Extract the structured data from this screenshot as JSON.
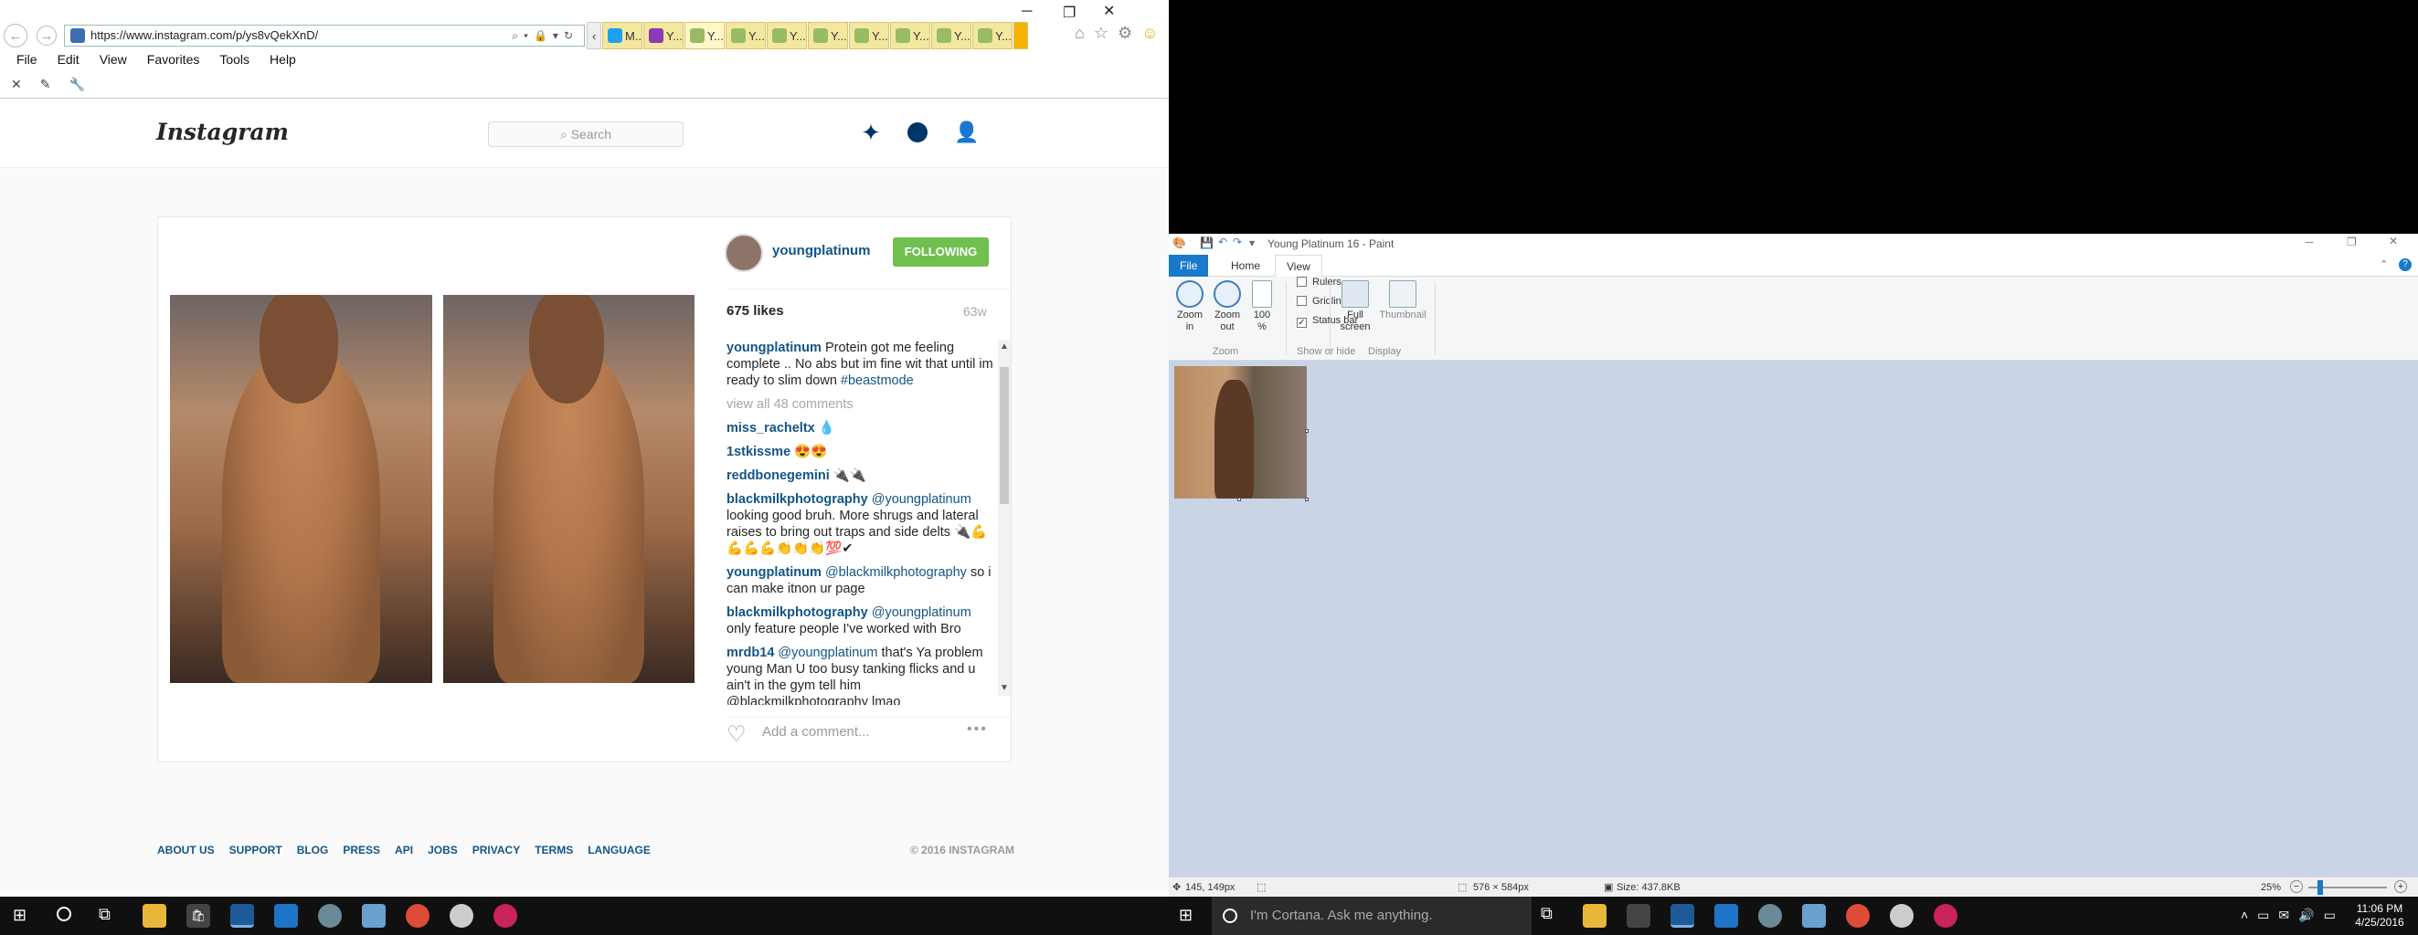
{
  "browser": {
    "url": "https://www.instagram.com/p/ys8vQekXnD/",
    "tabs": [
      "M...",
      "Y...",
      "Y... ×",
      "Y...",
      "Y...",
      "Y...",
      "Y...",
      "Y...",
      "Y...",
      "Y..."
    ],
    "menu": [
      "File",
      "Edit",
      "View",
      "Favorites",
      "Tools",
      "Help"
    ]
  },
  "instagram": {
    "logo": "Instagram",
    "search_placeholder": "Search",
    "username": "youngplatinum",
    "follow_label": "FOLLOWING",
    "likes": "675 likes",
    "age": "63w",
    "caption_user": "youngplatinum",
    "caption_text": "Protein got me feeling complete .. No abs but im fine wit that until im ready to slim down",
    "caption_tag": "#beastmode",
    "view_all": "view all 48 comments",
    "comments": [
      {
        "user": "miss_racheltx",
        "mention": "",
        "text": "💧"
      },
      {
        "user": "1stkissme",
        "mention": "",
        "text": "😍😍"
      },
      {
        "user": "reddbonegemini",
        "mention": "",
        "text": "🔌🔌"
      },
      {
        "user": "blackmilkphotography",
        "mention": "@youngplatinum",
        "text": "looking good bruh. More shrugs and lateral raises to bring out traps and side delts 🔌💪💪💪💪👏👏👏💯✔"
      },
      {
        "user": "youngplatinum",
        "mention": "@blackmilkphotography",
        "text": "so i can make itnon ur page"
      },
      {
        "user": "blackmilkphotography",
        "mention": "@youngplatinum",
        "text": "only feature people I've worked with Bro"
      },
      {
        "user": "mrdb14",
        "mention": "@youngplatinum",
        "text": "that's Ya problem young Man U too busy tanking flicks and u ain't in the gym tell him @blackmilkphotography lmao"
      }
    ],
    "add_comment": "Add a comment...",
    "footer_links": [
      "ABOUT US",
      "SUPPORT",
      "BLOG",
      "PRESS",
      "API",
      "JOBS",
      "PRIVACY",
      "TERMS",
      "LANGUAGE"
    ],
    "copyright": "© 2016 INSTAGRAM"
  },
  "paint": {
    "title": "Young Platinum 16 - Paint",
    "tabs": [
      "File",
      "Home",
      "View"
    ],
    "zoom_in": "Zoom in",
    "zoom_out": "Zoom out",
    "hundred": "100 %",
    "zoom_group": "Zoom",
    "rulers": "Rulers",
    "gridlines": "Gridlines",
    "statusbar_label": "Status bar",
    "show_hide_group": "Show or hide",
    "full_screen": "Full screen",
    "thumbnail": "Thumbnail",
    "display_group": "Display",
    "cursor_pos": "145, 149px",
    "image_size": "576 × 584px",
    "file_size": "Size: 437.8KB",
    "zoom_level": "25%"
  },
  "taskbar": {
    "cortana": "I'm Cortana. Ask me anything.",
    "time": "11:06 PM",
    "date": "4/25/2016"
  }
}
